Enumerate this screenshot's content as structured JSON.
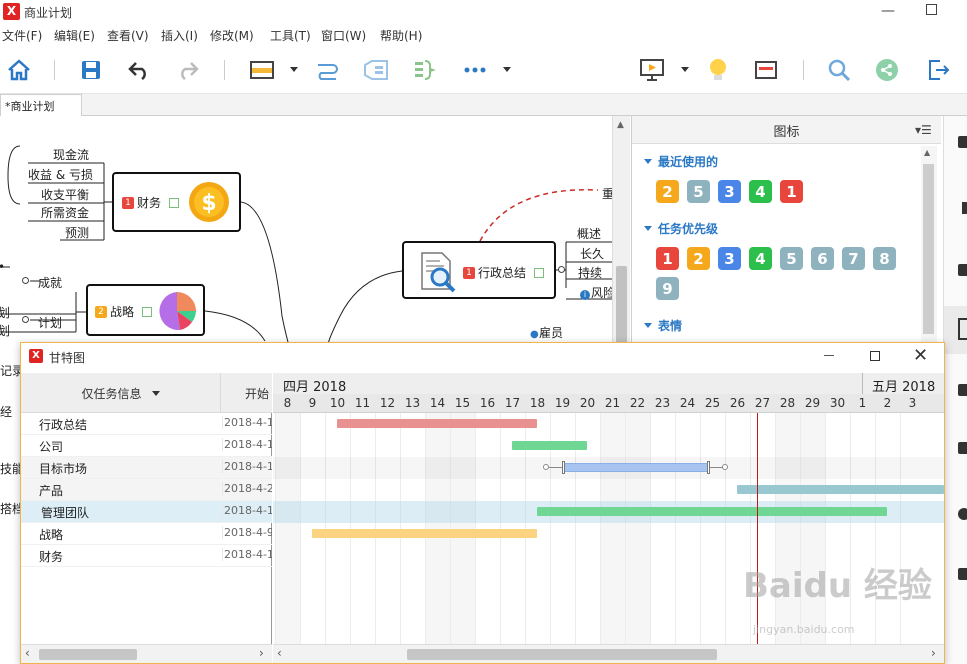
{
  "window": {
    "title": "商业计划",
    "logo": "X"
  },
  "menu": [
    "文件(F)",
    "编辑(E)",
    "查看(V)",
    "插入(I)",
    "修改(M)",
    "工具(T)",
    "窗口(W)",
    "帮助(H)"
  ],
  "tab": {
    "label": "*商业计划"
  },
  "map": {
    "finance": {
      "label": "财务",
      "badge": "1",
      "children": [
        "现金流",
        "收益 & 亏损",
        "收支平衡",
        "所需资金",
        "预测"
      ]
    },
    "strategy": {
      "label": "战略",
      "badge": "2",
      "children": [
        "成就",
        "计划"
      ]
    },
    "admin": {
      "label": "行政总结",
      "badge": "1",
      "children": [
        "概述",
        "长久",
        "持续",
        "风险"
      ]
    },
    "employee": "雇员",
    "partial_labels": [
      "重",
      "划",
      "划",
      "记录",
      "经",
      "技能",
      "搭档"
    ]
  },
  "panel": {
    "title": "图标",
    "recent": {
      "heading": "最近使用的",
      "items": [
        {
          "label": "2",
          "color": "#f5a81c"
        },
        {
          "label": "5",
          "color": "#8fb3be"
        },
        {
          "label": "3",
          "color": "#4a86e8"
        },
        {
          "label": "4",
          "color": "#2cbf4c"
        },
        {
          "label": "1",
          "color": "#e8453c"
        }
      ]
    },
    "priority": {
      "heading": "任务优先级",
      "items": [
        {
          "label": "1",
          "color": "#e8453c"
        },
        {
          "label": "2",
          "color": "#f5a81c"
        },
        {
          "label": "3",
          "color": "#4a86e8"
        },
        {
          "label": "4",
          "color": "#2cbf4c"
        },
        {
          "label": "5",
          "color": "#8fb3be"
        },
        {
          "label": "6",
          "color": "#8fb3be"
        },
        {
          "label": "7",
          "color": "#8fb3be"
        },
        {
          "label": "8",
          "color": "#8fb3be"
        },
        {
          "label": "9",
          "color": "#8fb3be"
        }
      ]
    },
    "emotion": {
      "heading": "表情"
    }
  },
  "gantt": {
    "title": "甘特图",
    "filter_label": "仅任务信息",
    "start_header": "开始",
    "months": [
      "四月 2018",
      "五月 2018"
    ],
    "days": [
      "8",
      "9",
      "10",
      "11",
      "12",
      "13",
      "14",
      "15",
      "16",
      "17",
      "18",
      "19",
      "20",
      "21",
      "22",
      "23",
      "24",
      "25",
      "26",
      "27",
      "28",
      "29",
      "30",
      "1",
      "2",
      "3"
    ],
    "tasks": [
      {
        "name": "行政总结",
        "start": "2018-4-1",
        "color": "#e99191"
      },
      {
        "name": "公司",
        "start": "2018-4-1",
        "color": "#6fd693"
      },
      {
        "name": "目标市场",
        "start": "2018-4-1",
        "color": "#a7c4f0"
      },
      {
        "name": "产品",
        "start": "2018-4-2",
        "color": "#99c8d0"
      },
      {
        "name": "管理团队",
        "start": "2018-4-1",
        "color": "#6fd693"
      },
      {
        "name": "战略",
        "start": "2018-4-9",
        "color": "#fcd381"
      },
      {
        "name": "财务",
        "start": "2018-4-1",
        "color": "#fcd381"
      }
    ]
  },
  "watermark": {
    "brand": "Baidu 经验",
    "url": "jingyan.baidu.com"
  }
}
